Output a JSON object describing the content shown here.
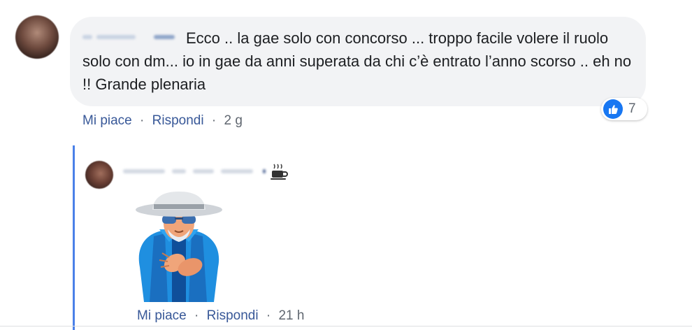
{
  "comment": {
    "text": "Ecco .. la gae solo con concorso ... troppo facile volere il ruolo solo con dm... io in gae da anni superata da chi c’è entrato l’anno scorso .. eh no !! Grande plenaria",
    "reaction": {
      "icon": "like-icon",
      "count": "7",
      "color": "#1877f2"
    },
    "actions": {
      "like": "Mi piace",
      "reply": "Rispondi",
      "separator": "·",
      "time": "2 g"
    }
  },
  "reply": {
    "name_icon": "coffee-icon",
    "sticker": "clapping-old-man-sticker",
    "actions": {
      "like": "Mi piace",
      "reply": "Rispondi",
      "separator": "·",
      "time": "21 h"
    },
    "thread_line_color": "#4a80e8"
  }
}
